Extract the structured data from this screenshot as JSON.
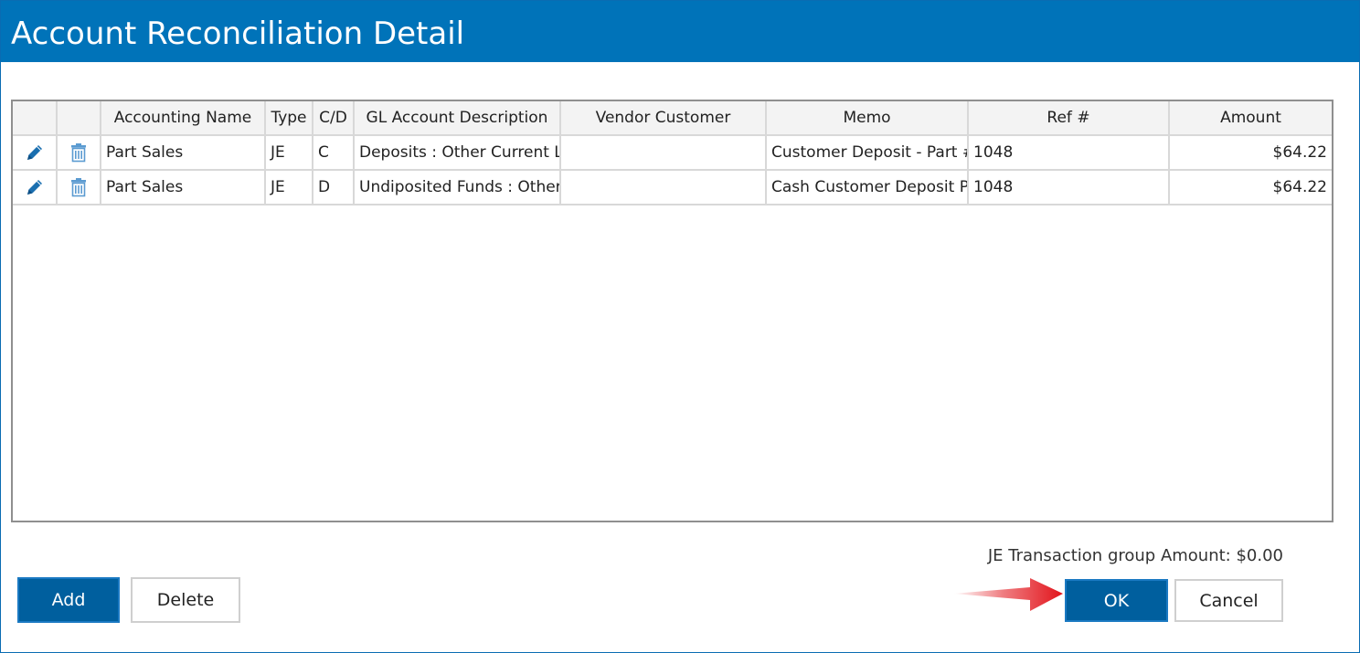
{
  "window": {
    "title": "Account Reconciliation Detail"
  },
  "grid": {
    "columns": [
      "",
      "",
      "Accounting Name",
      "Type",
      "C/D",
      "GL Account Description",
      "Vendor Customer",
      "Memo",
      "Ref #",
      "Amount"
    ],
    "rows": [
      {
        "edit_icon": "pencil-icon",
        "delete_icon": "trash-icon",
        "accounting_name": "Part Sales",
        "type": "JE",
        "cd": "C",
        "gl_account": "Deposits : Other Current Lia",
        "vendor_customer": "",
        "memo": "Customer Deposit - Part #",
        "ref": "1048",
        "amount": "$64.22"
      },
      {
        "edit_icon": "pencil-icon",
        "delete_icon": "trash-icon",
        "accounting_name": "Part Sales",
        "type": "JE",
        "cd": "D",
        "gl_account": "Undiposited Funds : Other",
        "vendor_customer": "",
        "memo": "Cash Customer Deposit Pa",
        "ref": "1048",
        "amount": "$64.22"
      }
    ]
  },
  "footer": {
    "total_label": "JE Transaction group Amount: $0.00",
    "add_label": "Add",
    "delete_label": "Delete",
    "ok_label": "OK",
    "cancel_label": "Cancel"
  },
  "colors": {
    "title_bar": "#0073b9",
    "primary_button": "#005f9e",
    "icon_blue": "#1a6fb0",
    "arrow_red": "#e2141b"
  }
}
